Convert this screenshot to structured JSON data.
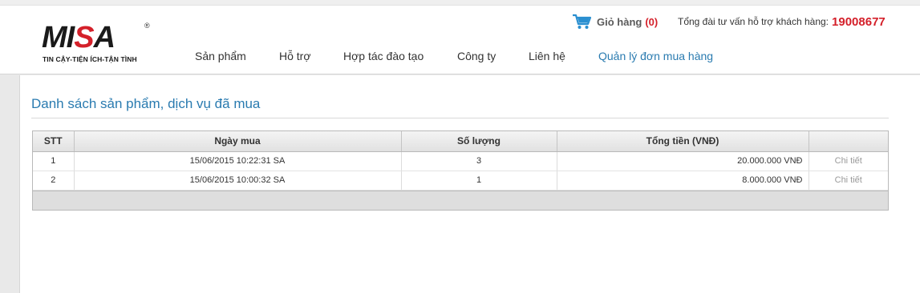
{
  "logo": {
    "word_a": "MI",
    "word_b": "S",
    "word_c": "A",
    "reg": "®",
    "tagline": "TIN CẬY-TIỆN ÍCH-TẬN TÌNH"
  },
  "cart": {
    "label": "Giỏ hàng",
    "count": "(0)",
    "icon": "shopping-cart-icon"
  },
  "hotline": {
    "label": "Tổng đài tư vấn hỗ trợ khách hàng:",
    "number": "19008677"
  },
  "nav": [
    {
      "label": "Sản phẩm"
    },
    {
      "label": "Hỗ trợ"
    },
    {
      "label": "Hợp tác đào tạo"
    },
    {
      "label": "Công ty"
    },
    {
      "label": "Liên hệ"
    },
    {
      "label": "Quản lý đơn mua hàng",
      "active": true
    }
  ],
  "page": {
    "title": "Danh sách sản phẩm, dịch vụ đã mua"
  },
  "table": {
    "columns": [
      "STT",
      "Ngày mua",
      "Số lượng",
      "Tổng tiền (VNĐ)",
      ""
    ],
    "rows": [
      {
        "stt": "1",
        "date": "15/06/2015 10:22:31 SA",
        "qty": "3",
        "total": "20.000.000 VNĐ",
        "action": "Chi tiết"
      },
      {
        "stt": "2",
        "date": "15/06/2015 10:00:32 SA",
        "qty": "1",
        "total": "8.000.000 VNĐ",
        "action": "Chi tiết"
      }
    ]
  },
  "colors": {
    "accent": "#2a7bb0",
    "brand_red": "#d4202a"
  }
}
